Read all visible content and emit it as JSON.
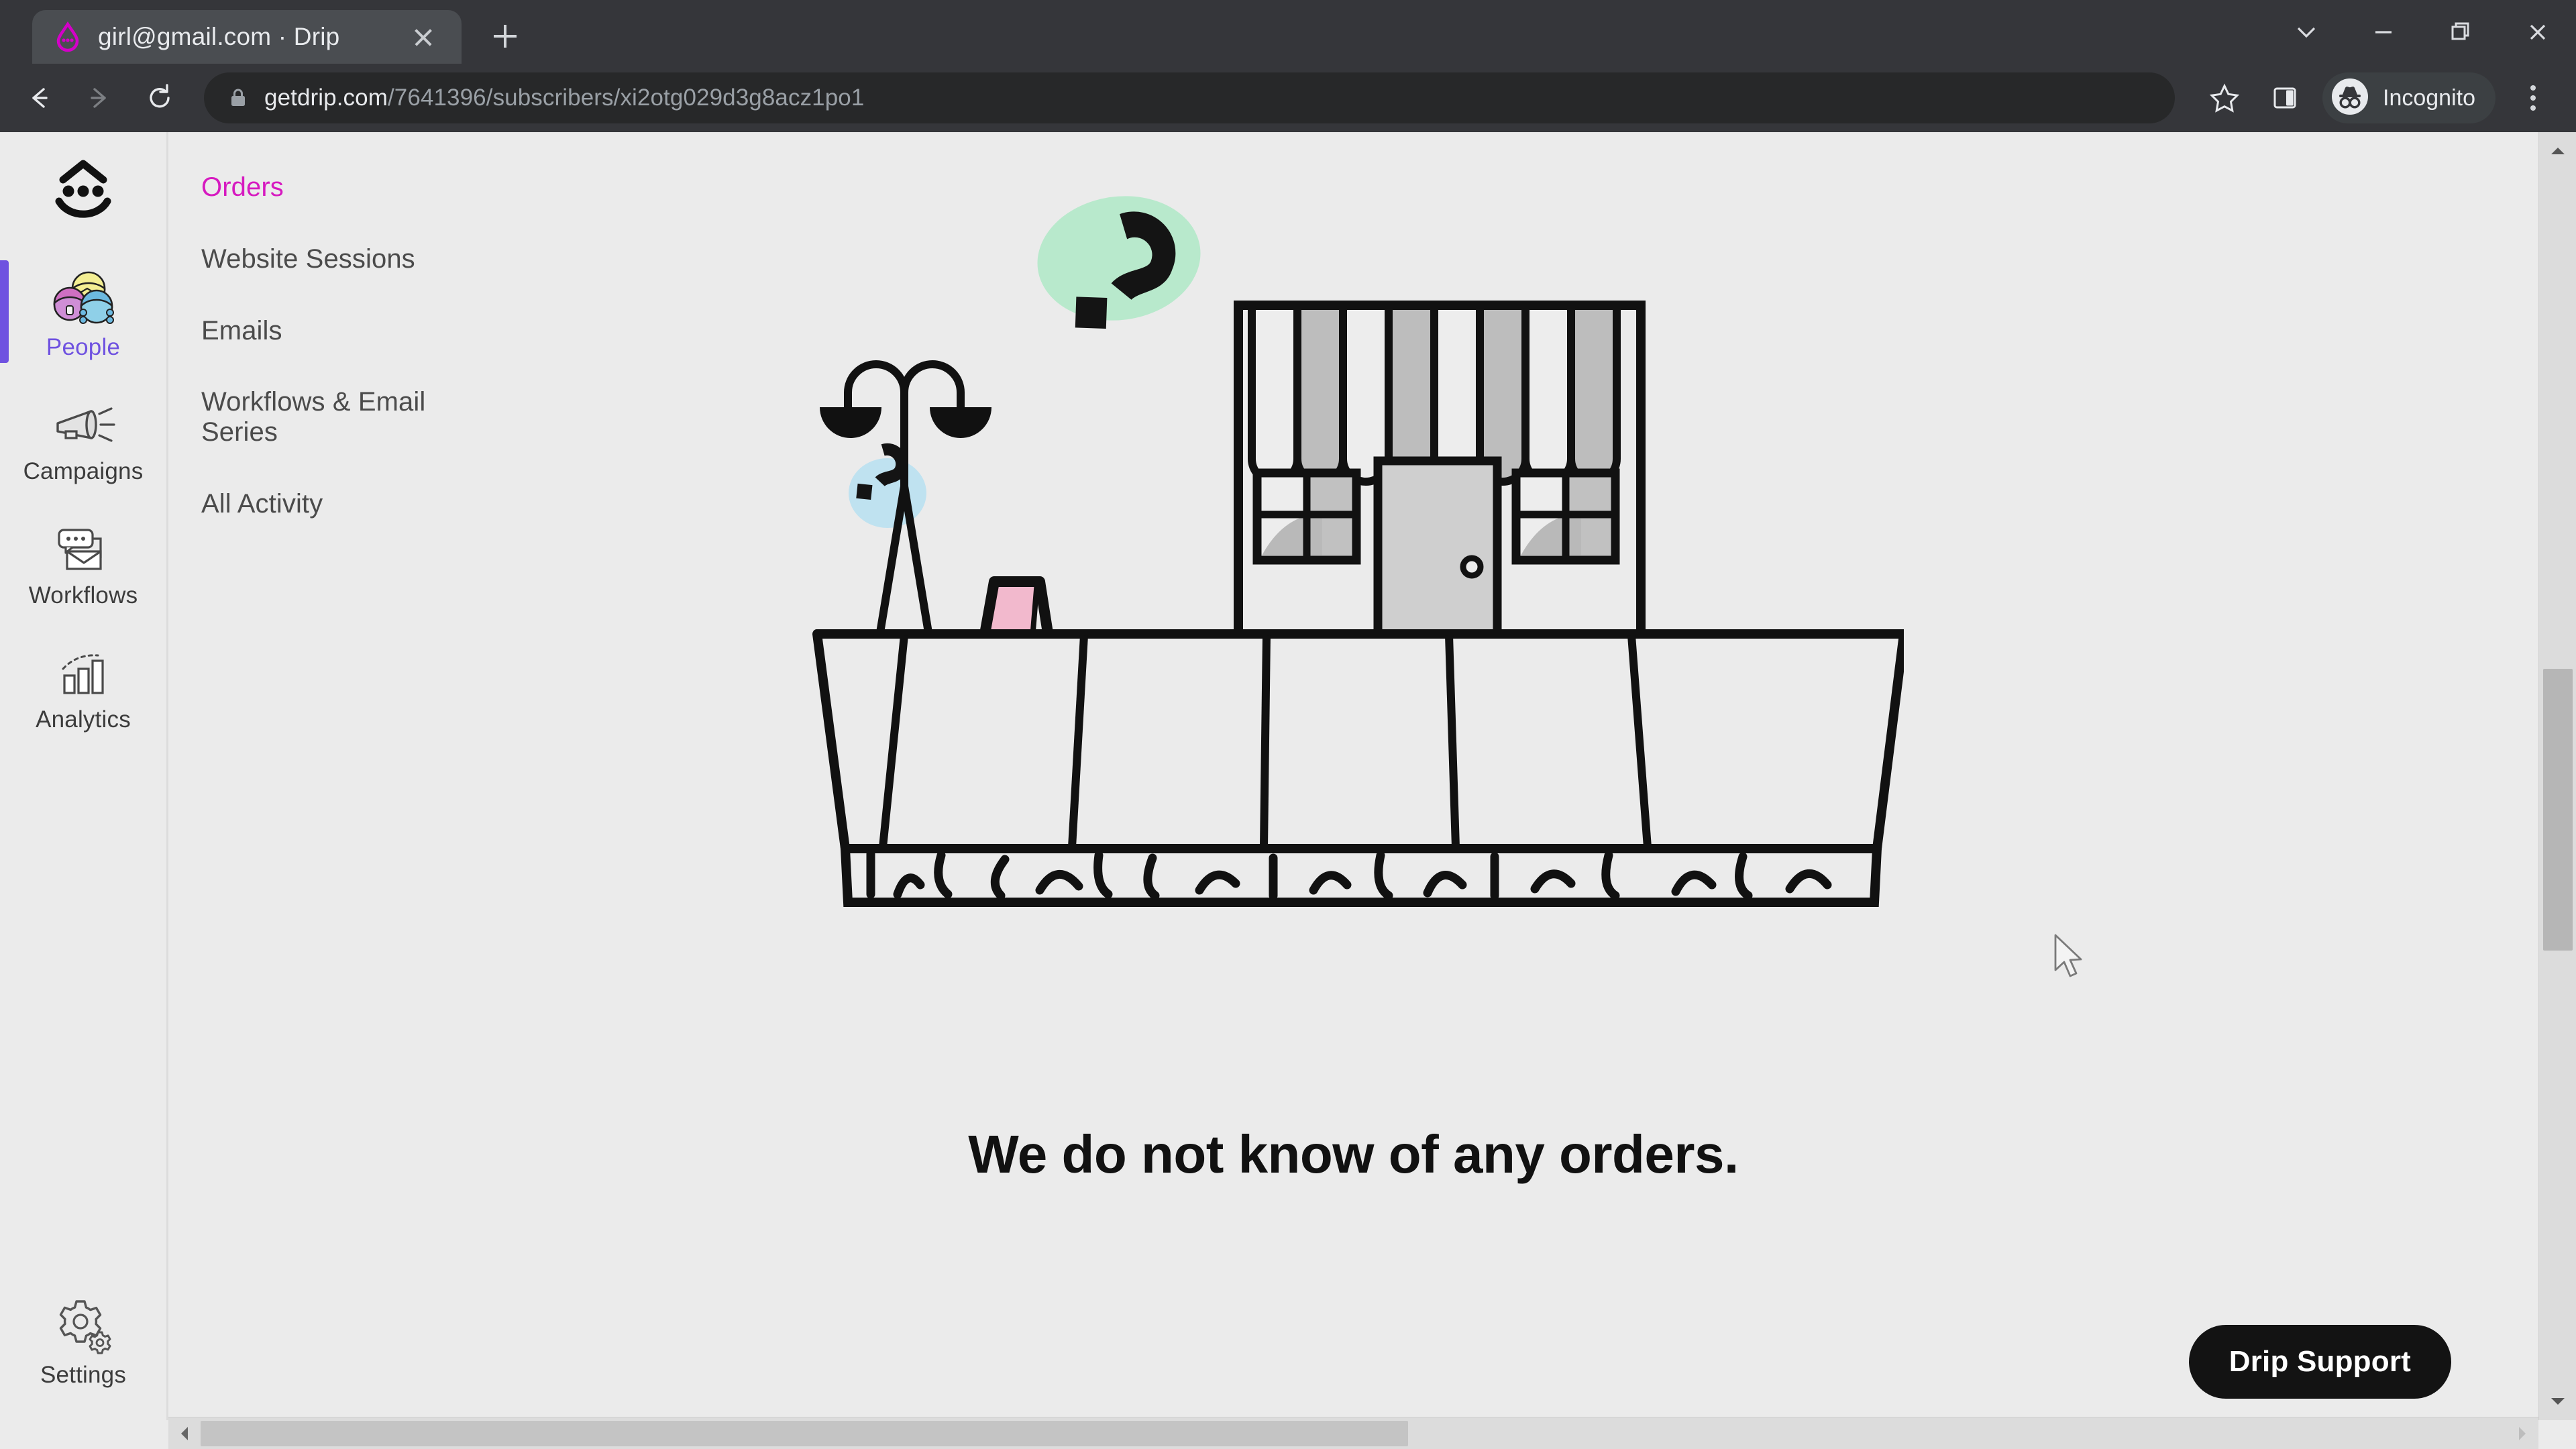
{
  "browser": {
    "tab": {
      "title": "girl@gmail.com · Drip",
      "favicon_icon": "drip-logo-icon",
      "close_icon": "close-icon"
    },
    "new_tab_icon": "plus-icon",
    "window_controls": [
      {
        "name": "tab-search",
        "icon": "chevron-down-icon"
      },
      {
        "name": "minimize",
        "icon": "minimize-icon"
      },
      {
        "name": "restore",
        "icon": "restore-icon"
      },
      {
        "name": "close",
        "icon": "close-icon"
      }
    ],
    "toolbar": {
      "back_icon": "arrow-left-icon",
      "forward_icon": "arrow-right-icon",
      "reload_icon": "reload-icon",
      "lock_icon": "lock-icon",
      "url_domain": "getdrip.com",
      "url_path": "/7641396/subscribers/xi2otg029d3g8acz1po1",
      "bookmark_icon": "star-icon",
      "side_panel_icon": "side-panel-icon",
      "incognito_icon": "incognito-icon",
      "incognito_label": "Incognito",
      "menu_icon": "three-dots-icon"
    }
  },
  "rail": {
    "logo_icon": "drip-face-logo-icon",
    "items": [
      {
        "label": "People",
        "icon": "people-icon",
        "active": true
      },
      {
        "label": "Campaigns",
        "icon": "megaphone-icon",
        "active": false
      },
      {
        "label": "Workflows",
        "icon": "workflow-icon",
        "active": false
      },
      {
        "label": "Analytics",
        "icon": "bar-chart-icon",
        "active": false
      }
    ],
    "settings": {
      "label": "Settings",
      "icon": "gear-icon"
    }
  },
  "subnav": {
    "items": [
      {
        "label": "Orders",
        "active": true
      },
      {
        "label": "Website Sessions",
        "active": false
      },
      {
        "label": "Emails",
        "active": false
      },
      {
        "label": "Workflows & Email Series",
        "active": false
      },
      {
        "label": "All Activity",
        "active": false
      }
    ]
  },
  "main": {
    "empty_state_title": "We do not know of any orders.",
    "illustration_name": "closed-storefront-illustration"
  },
  "support": {
    "label": "Drip Support"
  },
  "colors": {
    "accent_purple": "#6f52e0",
    "accent_magenta": "#d61ac0",
    "page_bg": "#ebebeb",
    "chrome_bg": "#35363a",
    "blob_green": "#b8e9cc",
    "blob_pink": "#e4aee8",
    "blob_blue": "#bfe2f0",
    "sign_pink": "#f2b9cd",
    "awning_gray": "#bdbdbd",
    "door_gray": "#cfcfcf",
    "support_btn_bg": "#131313"
  },
  "scrollbars": {
    "vertical_name": "vertical-scrollbar",
    "horizontal_name": "horizontal-scrollbar"
  }
}
